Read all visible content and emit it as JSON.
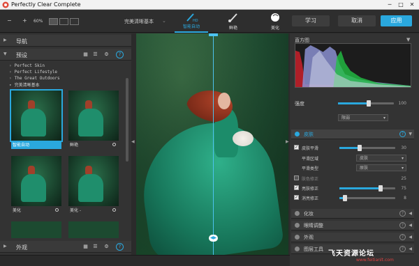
{
  "window": {
    "title": "Perfectly Clear Complete",
    "minimize": "─",
    "maximize": "□",
    "close": "✕"
  },
  "toolbar": {
    "zoom_out": "−",
    "zoom_in": "+",
    "zoom": "60%",
    "preset_name": "完美清晰基本",
    "tools": [
      {
        "label": "智能自动",
        "icon": "hd-brush-icon"
      },
      {
        "label": "鲜艳",
        "icon": "brush-icon"
      },
      {
        "label": "美化",
        "icon": "face-icon"
      }
    ],
    "learn": "学习",
    "cancel": "取消",
    "apply": "应用"
  },
  "left": {
    "nav": {
      "label": "导航"
    },
    "presets": {
      "label": "预设",
      "items": [
        "Perfect Skin",
        "Perfect Lifestyle",
        "The Great Outdoors",
        "完美清晰基本"
      ]
    },
    "thumbs": [
      {
        "label": "智能自动"
      },
      {
        "label": "鲜艳"
      },
      {
        "label": "美化"
      },
      {
        "label": "美化 -"
      }
    ],
    "appearance": {
      "label": "外观"
    }
  },
  "right": {
    "histogram_label": "直方图",
    "strength_label": "强度",
    "strength_value": "100",
    "mode": "限弱",
    "skin": {
      "label": "皮肤",
      "rows": [
        {
          "label": "皮肤平滑",
          "value": "30",
          "fraction": 0.32,
          "checked": true
        },
        {
          "label": "平滑区域",
          "dropdown": "皮肤",
          "checked": false,
          "dropdown_only": true
        },
        {
          "label": "平滑类型",
          "dropdown": "原肤",
          "checked": false,
          "dropdown_only": true
        },
        {
          "label": "肤色修正",
          "value": "25",
          "fraction": 0.0,
          "checked": false,
          "disabled": true
        },
        {
          "label": "亮肤修正",
          "value": "75",
          "fraction": 0.75,
          "checked": true
        },
        {
          "label": "消亮修正",
          "value": "8",
          "fraction": 0.08,
          "checked": true
        }
      ]
    },
    "sections": [
      "化妆",
      "眼睛调整",
      "外观",
      "图层工具"
    ]
  },
  "watermark": "飞天资源论坛",
  "watermark_sub": "www.feitianlt.com",
  "colors": {
    "accent": "#2aa8de"
  }
}
